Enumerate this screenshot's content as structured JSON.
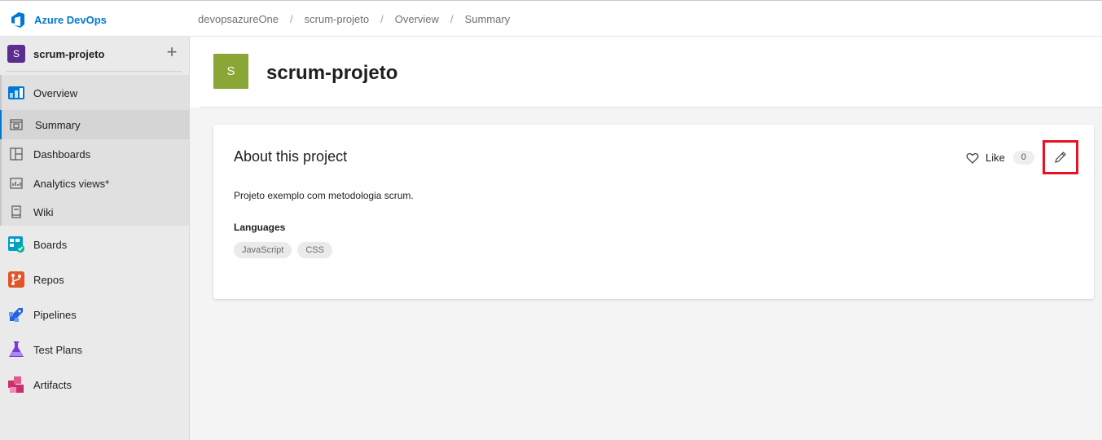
{
  "app": {
    "name": "Azure DevOps",
    "brand_color": "#0078d4"
  },
  "breadcrumb": [
    "devopsazureOne",
    "scrum-projeto",
    "Overview",
    "Summary"
  ],
  "breadcrumb_separator": "/",
  "project": {
    "initial": "S",
    "name": "scrum-projeto",
    "add_icon": "plus-icon"
  },
  "sidebar": {
    "items": [
      {
        "label": "Overview",
        "icon": "overview-icon"
      },
      {
        "label": "Summary",
        "icon": "summary-icon",
        "active": true
      },
      {
        "label": "Dashboards",
        "icon": "dashboards-icon"
      },
      {
        "label": "Analytics views*",
        "icon": "analytics-icon"
      },
      {
        "label": "Wiki",
        "icon": "wiki-icon"
      },
      {
        "label": "Boards",
        "icon": "boards-icon"
      },
      {
        "label": "Repos",
        "icon": "repos-icon"
      },
      {
        "label": "Pipelines",
        "icon": "pipelines-icon"
      },
      {
        "label": "Test Plans",
        "icon": "test-plans-icon"
      },
      {
        "label": "Artifacts",
        "icon": "artifacts-icon"
      }
    ]
  },
  "page": {
    "badge_initial": "S",
    "title": "scrum-projeto",
    "badge_color": "#8aa636"
  },
  "about": {
    "title": "About this project",
    "like_label": "Like",
    "like_count": "0",
    "description": "Projeto exemplo com metodologia scrum.",
    "languages_title": "Languages",
    "languages": [
      "JavaScript",
      "CSS"
    ],
    "highlight_color": "#e81123"
  }
}
